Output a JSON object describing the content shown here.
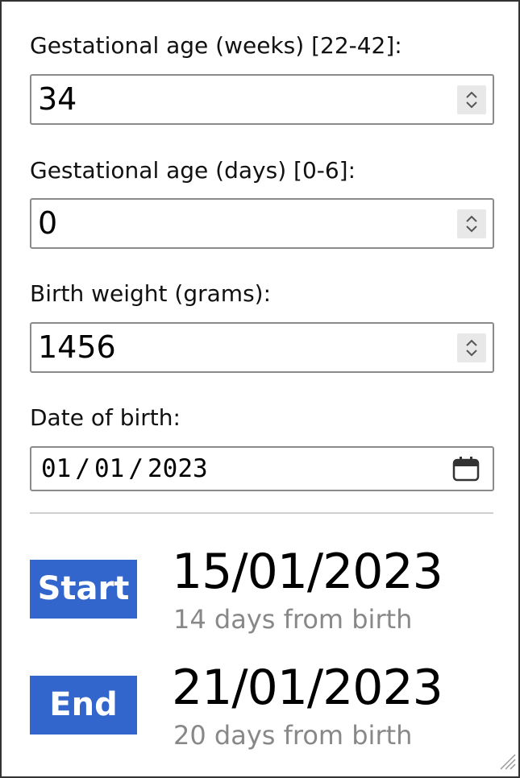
{
  "form": {
    "weeks": {
      "label": "Gestational age (weeks) [22-42]:",
      "value": "34"
    },
    "days": {
      "label": "Gestational age (days) [0-6]:",
      "value": "0"
    },
    "weight": {
      "label": "Birth weight (grams):",
      "value": "1456"
    },
    "dob": {
      "label": "Date of birth:",
      "day": "01",
      "month": "01",
      "year": "2023",
      "separator": "/"
    }
  },
  "results": {
    "start": {
      "badge": "Start",
      "date": "15/01/2023",
      "subtext": "14 days from birth"
    },
    "end": {
      "badge": "End",
      "date": "21/01/2023",
      "subtext": "20 days from birth"
    }
  },
  "colors": {
    "badge_bg": "#3366cc",
    "badge_text": "#ffffff",
    "subtext": "#888888"
  },
  "icons": {
    "spinner": "up-down-chevron-icon",
    "calendar": "calendar-icon",
    "resize": "resize-grip-icon"
  }
}
